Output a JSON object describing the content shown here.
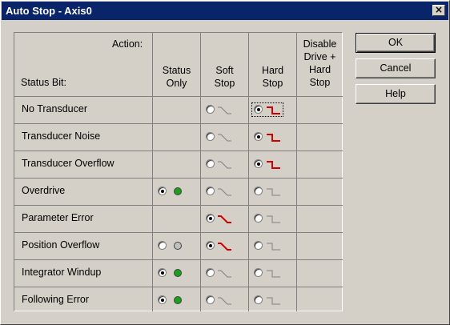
{
  "window": {
    "title": "Auto Stop - Axis0"
  },
  "header": {
    "action_label": "Action:",
    "status_bit_label": "Status Bit:",
    "columns": [
      "Status Only",
      "Soft Stop",
      "Hard Stop",
      "Disable Drive + Hard Stop"
    ]
  },
  "rows": [
    {
      "label": "No Transducer",
      "status_only": null,
      "soft": false,
      "hard": true,
      "hard_focus": true
    },
    {
      "label": "Transducer Noise",
      "status_only": null,
      "soft": false,
      "hard": true
    },
    {
      "label": "Transducer Overflow",
      "status_only": null,
      "soft": false,
      "hard": true
    },
    {
      "label": "Overdrive",
      "status_only": "on",
      "soft": false,
      "hard": false
    },
    {
      "label": "Parameter Error",
      "status_only": null,
      "soft": true,
      "hard": false
    },
    {
      "label": "Position Overflow",
      "status_only": "off",
      "soft": true,
      "hard": false
    },
    {
      "label": "Integrator Windup",
      "status_only": "on",
      "soft": false,
      "hard": false
    },
    {
      "label": "Following Error",
      "status_only": "on",
      "soft": false,
      "hard": false
    }
  ],
  "buttons": {
    "ok": "OK",
    "cancel": "Cancel",
    "help": "Help"
  },
  "colors": {
    "title_bar": "#0a246a",
    "face": "#d4d0c8",
    "led_on": "#1aa01a",
    "led_off": "#c0c0c0",
    "active_icon": "#d00000",
    "inactive_icon": "#808080"
  },
  "icons": {
    "close": "close-icon",
    "soft_stop": "soft-stop-icon",
    "hard_stop": "hard-stop-icon",
    "status_led": "status-led-icon"
  }
}
